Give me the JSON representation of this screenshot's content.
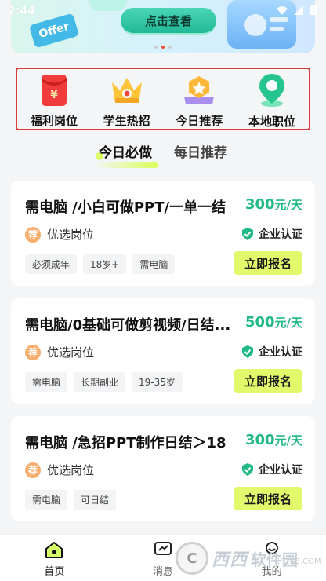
{
  "status_bar": {
    "time": "2:44"
  },
  "banner": {
    "cta": "点击查看",
    "tag": "Offer"
  },
  "categories": [
    {
      "label": "福利岗位",
      "icon": "red-envelope-icon"
    },
    {
      "label": "学生热招",
      "icon": "crown-icon"
    },
    {
      "label": "今日推荐",
      "icon": "star-badge-icon"
    },
    {
      "label": "本地职位",
      "icon": "location-pin-icon"
    }
  ],
  "tabs": [
    {
      "label": "今日必做",
      "active": true
    },
    {
      "label": "每日推荐",
      "active": false
    }
  ],
  "jobs": [
    {
      "title": "需电脑 /小白可做PPT/一单一结",
      "salary": "300",
      "unit": "元/天",
      "badge": "荐",
      "tag": "优选岗位",
      "verify": "企业认证",
      "chips": [
        "必须成年",
        "18岁+",
        "需电脑"
      ],
      "apply": "立即报名"
    },
    {
      "title": "需电脑/0基础可做剪视频/日结...",
      "salary": "500",
      "unit": "元/天",
      "badge": "荐",
      "tag": "优选岗位",
      "verify": "企业认证",
      "chips": [
        "需电脑",
        "长期副业",
        "19-35岁"
      ],
      "apply": "立即报名"
    },
    {
      "title": "需电脑 /急招PPT制作日结＞18",
      "salary": "300",
      "unit": "元/天",
      "badge": "荐",
      "tag": "优选岗位",
      "verify": "企业认证",
      "chips": [
        "需电脑",
        "可日结"
      ],
      "apply": "立即报名"
    }
  ],
  "bottom_nav": [
    {
      "label": "首页",
      "icon": "home-icon",
      "active": true
    },
    {
      "label": "消息",
      "icon": "message-icon",
      "active": false
    },
    {
      "label": "我的",
      "icon": "profile-icon",
      "active": false
    }
  ],
  "watermark": {
    "text": "西西",
    "site": "软件园",
    "sub": "CR173.COM"
  },
  "colors": {
    "accent_green": "#22b987",
    "button_lime": "#e3f96c",
    "highlight_red": "#d6403a"
  }
}
